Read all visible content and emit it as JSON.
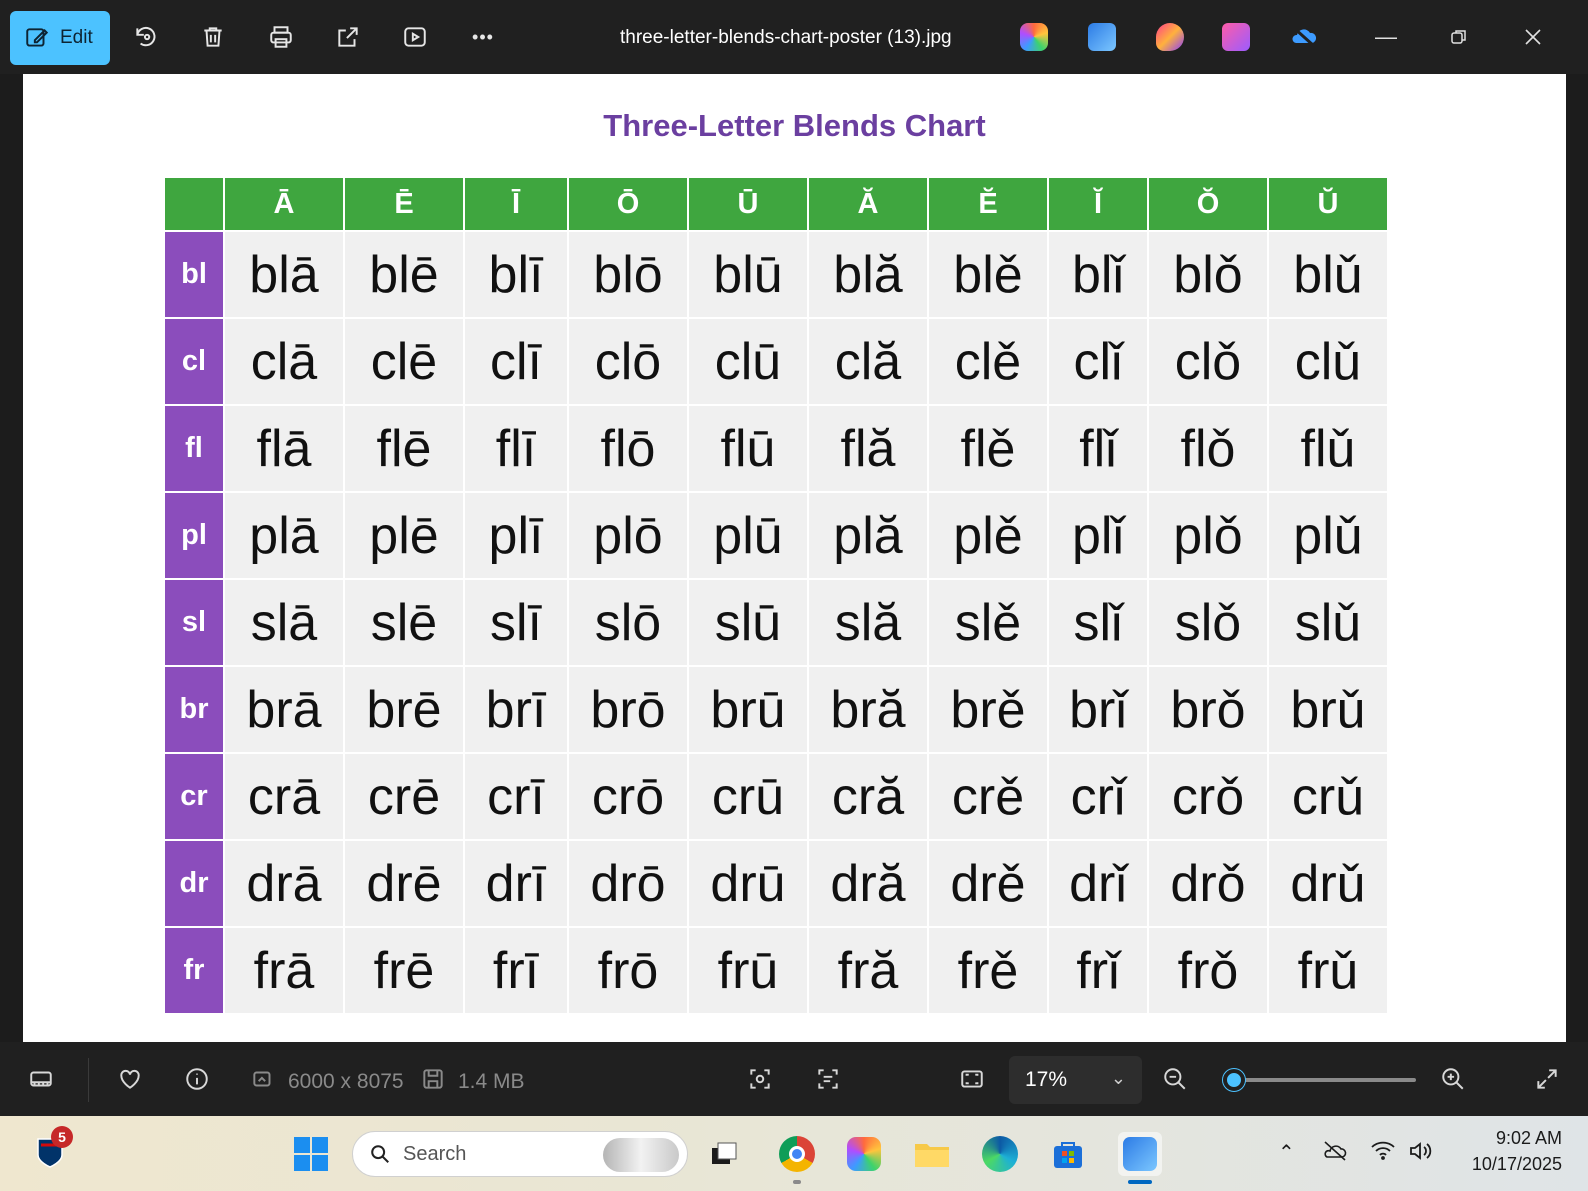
{
  "toolbar": {
    "edit_label": "Edit",
    "file_title": "three-letter-blends-chart-poster (13).jpg",
    "more_label": "•••"
  },
  "chart": {
    "title": "Three-Letter Blends Chart",
    "vowels": [
      "Ā",
      "Ē",
      "Ī",
      "Ō",
      "Ū",
      "Ă",
      "Ĕ",
      "Ĭ",
      "Ŏ",
      "Ŭ"
    ],
    "rows": [
      {
        "blend": "bl",
        "cells": [
          "blā",
          "blē",
          "blī",
          "blō",
          "blū",
          "blă",
          "blě",
          "blǐ",
          "blǒ",
          "blǔ"
        ]
      },
      {
        "blend": "cl",
        "cells": [
          "clā",
          "clē",
          "clī",
          "clō",
          "clū",
          "clă",
          "clě",
          "clǐ",
          "clǒ",
          "clǔ"
        ]
      },
      {
        "blend": "fl",
        "cells": [
          "flā",
          "flē",
          "flī",
          "flō",
          "flū",
          "flă",
          "flě",
          "flǐ",
          "flǒ",
          "flǔ"
        ]
      },
      {
        "blend": "pl",
        "cells": [
          "plā",
          "plē",
          "plī",
          "plō",
          "plū",
          "plă",
          "plě",
          "plǐ",
          "plǒ",
          "plǔ"
        ]
      },
      {
        "blend": "sl",
        "cells": [
          "slā",
          "slē",
          "slī",
          "slō",
          "slū",
          "slă",
          "slě",
          "slǐ",
          "slǒ",
          "slǔ"
        ]
      },
      {
        "blend": "br",
        "cells": [
          "brā",
          "brē",
          "brī",
          "brō",
          "brū",
          "bră",
          "brě",
          "brǐ",
          "brǒ",
          "brǔ"
        ]
      },
      {
        "blend": "cr",
        "cells": [
          "crā",
          "crē",
          "crī",
          "crō",
          "crū",
          "cră",
          "crě",
          "crǐ",
          "crǒ",
          "crǔ"
        ]
      },
      {
        "blend": "dr",
        "cells": [
          "drā",
          "drē",
          "drī",
          "drō",
          "drū",
          "dră",
          "drě",
          "drǐ",
          "drǒ",
          "drǔ"
        ]
      },
      {
        "blend": "fr",
        "cells": [
          "frā",
          "frē",
          "frī",
          "frō",
          "frū",
          "fră",
          "frě",
          "frǐ",
          "frǒ",
          "frǔ"
        ]
      }
    ]
  },
  "status": {
    "dimensions": "6000 x 8075",
    "file_size": "1.4 MB",
    "zoom": "17%",
    "zoom_level": 0.04
  },
  "taskbar": {
    "search_placeholder": "Search",
    "nfl_badge": "5",
    "time": "9:02 AM",
    "date": "10/17/2025"
  },
  "colors": {
    "accent": "#4cc2ff",
    "header_green": "#3fa63f",
    "row_purple": "#8b4dbc",
    "title_purple": "#6b3fa0"
  }
}
